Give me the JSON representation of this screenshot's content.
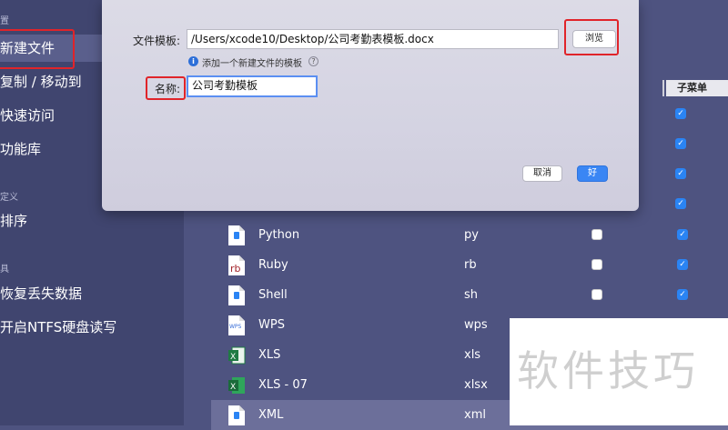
{
  "sidebar": {
    "section_top": "置",
    "section_custom": "定义",
    "section_tools": "具",
    "items": {
      "new_file": "新建文件",
      "copy_move": "复制 / 移动到",
      "quick_access": "快速访问",
      "features": "功能库",
      "sort": "排序",
      "recover": "恢复丢失数据",
      "ntfs": "开启NTFS硬盘读写"
    }
  },
  "table": {
    "submenu_header": "子菜单",
    "rows": [
      {
        "name": "Python",
        "ext": "py",
        "icon": "python-file-icon",
        "enabled": false,
        "submenu": true
      },
      {
        "name": "Ruby",
        "ext": "rb",
        "icon": "ruby-file-icon",
        "enabled": false,
        "submenu": true
      },
      {
        "name": "Shell",
        "ext": "sh",
        "icon": "shell-file-icon",
        "enabled": false,
        "submenu": true
      },
      {
        "name": "WPS",
        "ext": "wps",
        "icon": "wps-file-icon"
      },
      {
        "name": "XLS",
        "ext": "xls",
        "icon": "excel-file-icon"
      },
      {
        "name": "XLS - 07",
        "ext": "xlsx",
        "icon": "excel-file-icon"
      },
      {
        "name": "XML",
        "ext": "xml",
        "icon": "xml-file-icon",
        "selected": true
      }
    ]
  },
  "dialog": {
    "template_label": "文件模板:",
    "template_value": "/Users/xcode10/Desktop/公司考勤表模板.docx",
    "browse_label": "浏览",
    "hint_text": "添加一个新建文件的模板",
    "name_label": "名称:",
    "name_value": "公司考勤模板",
    "cancel_label": "取消",
    "ok_label": "好"
  },
  "watermark": "软件技巧",
  "colors": {
    "highlight": "#e0242a",
    "accent": "#3a86f4",
    "sidebar": "#40456f",
    "main": "#4e5380"
  }
}
